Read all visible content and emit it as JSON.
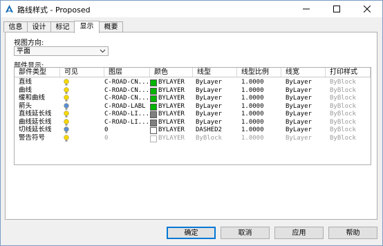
{
  "window": {
    "title": "路线样式 - Proposed",
    "controls": [
      "minimize-icon",
      "maximize-icon",
      "close-icon"
    ]
  },
  "tabs": [
    {
      "label": "信息",
      "active": false
    },
    {
      "label": "设计",
      "active": false
    },
    {
      "label": "标记",
      "active": false
    },
    {
      "label": "显示",
      "active": true
    },
    {
      "label": "概要",
      "active": false
    }
  ],
  "view_direction": {
    "label": "视图方向:",
    "value": "平面"
  },
  "components": {
    "label": "部件显示:",
    "columns": [
      "部件类型",
      "可见",
      "图层",
      "颜色",
      "线型",
      "线型比例",
      "线宽",
      "打印样式"
    ],
    "rows": [
      {
        "type": "直线",
        "visible": "on",
        "layer": "C-ROAD-CN...",
        "color": "BYLAYER",
        "swatch": "#00b400",
        "linetype": "ByLayer",
        "scale": "1.0000",
        "lineweight": "ByLayer",
        "plotstyle": "ByBlock",
        "disabled": false
      },
      {
        "type": "曲线",
        "visible": "on",
        "layer": "C-ROAD-CN...",
        "color": "BYLAYER",
        "swatch": "#00b400",
        "linetype": "ByLayer",
        "scale": "1.0000",
        "lineweight": "ByLayer",
        "plotstyle": "ByBlock",
        "disabled": false
      },
      {
        "type": "缓和曲线",
        "visible": "on",
        "layer": "C-ROAD-CN...",
        "color": "BYLAYER",
        "swatch": "#00b400",
        "linetype": "ByLayer",
        "scale": "1.0000",
        "lineweight": "ByLayer",
        "plotstyle": "ByBlock",
        "disabled": false
      },
      {
        "type": "箭头",
        "visible": "off",
        "layer": "C-ROAD-LABL",
        "color": "BYLAYER",
        "swatch": "#00b400",
        "linetype": "ByLayer",
        "scale": "1.0000",
        "lineweight": "ByLayer",
        "plotstyle": "ByBlock",
        "disabled": false
      },
      {
        "type": "直线延长线",
        "visible": "on",
        "layer": "C-ROAD-LI...",
        "color": "BYLAYER",
        "swatch": "#808080",
        "linetype": "ByLayer",
        "scale": "1.0000",
        "lineweight": "ByLayer",
        "plotstyle": "ByBlock",
        "disabled": false
      },
      {
        "type": "曲线延长线",
        "visible": "on",
        "layer": "C-ROAD-LI...",
        "color": "BYLAYER",
        "swatch": "#808080",
        "linetype": "ByLayer",
        "scale": "1.0000",
        "lineweight": "ByLayer",
        "plotstyle": "ByBlock",
        "disabled": false
      },
      {
        "type": "切线延长线",
        "visible": "off",
        "layer": "0",
        "color": "BYLAYER",
        "swatch": "#ffffff",
        "linetype": "DASHED2",
        "scale": "1.0000",
        "lineweight": "ByLayer",
        "plotstyle": "ByBlock",
        "disabled": false
      },
      {
        "type": "警告符号",
        "visible": "on",
        "layer": "0",
        "color": "BYLAYER",
        "swatch": "#ffffff",
        "linetype": "ByBlock",
        "scale": "1.0000",
        "lineweight": "ByLayer",
        "plotstyle": "ByBlock",
        "disabled": true
      }
    ]
  },
  "buttons": {
    "ok": "确定",
    "cancel": "取消",
    "apply": "应用",
    "help": "帮助"
  },
  "colors": {
    "accent": "#0078d7",
    "bulb_on": "#f5d800",
    "bulb_off": "#5b8fd6"
  }
}
